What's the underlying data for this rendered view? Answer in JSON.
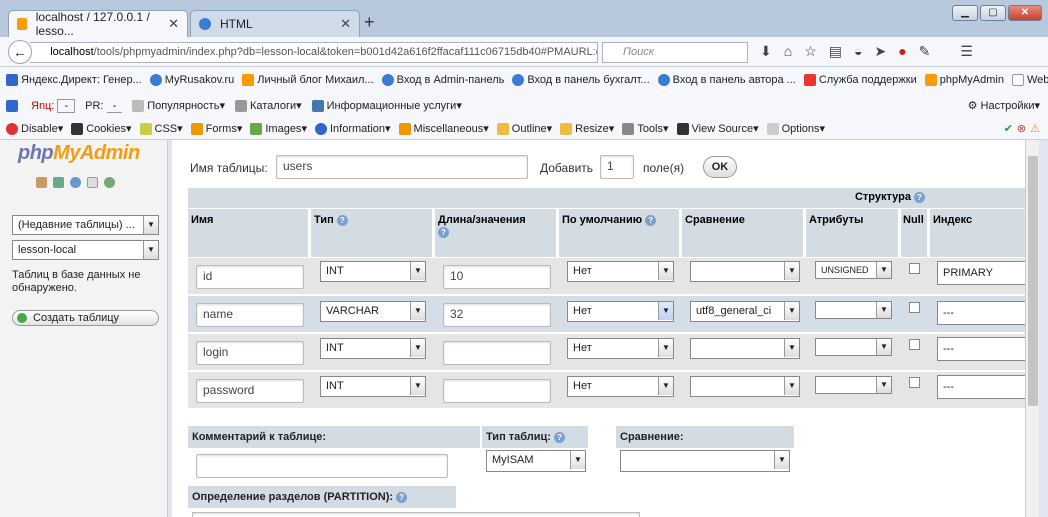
{
  "browser": {
    "tabs": [
      {
        "label": "localhost / 127.0.0.1 / lesso..."
      },
      {
        "label": "HTML"
      }
    ],
    "url_prefix": "localhost",
    "url_rest": "/tools/phpmyadmin/index.php?db=lesson-local&token=b001d42a616f2ffacaf111c06715db40#PMAURL:db=l",
    "search_placeholder": "Поиск",
    "bookmarks": [
      "Яндекс.Директ: Генер...",
      "MyRusakov.ru",
      "Личный блог Михаил...",
      "Вход в Admin-панель",
      "Вход в панель бухгалт...",
      "Вход в панель автора ...",
      "Служба поддержки",
      "phpMyAdmin",
      "WebMoney"
    ],
    "yandex_bar": {
      "tic": "Яnц:",
      "tic_val": "-",
      "pr": "PR:",
      "pr_val": "-",
      "items": [
        "Популярность",
        "Каталоги",
        "Информационные услуги"
      ],
      "settings": "Настройки"
    },
    "webdev": [
      "Disable",
      "Cookies",
      "CSS",
      "Forms",
      "Images",
      "Information",
      "Miscellaneous",
      "Outline",
      "Resize",
      "Tools",
      "View Source",
      "Options"
    ]
  },
  "sidebar": {
    "logo_php": "php",
    "logo_my": "MyAdmin",
    "recent": "(Недавние таблицы) ...",
    "db": "lesson-local",
    "no_tables": "Таблиц в базе данных не обнаружено.",
    "create": "Создать таблицу"
  },
  "form": {
    "table_name_label": "Имя таблицы:",
    "table_name": "users",
    "add_label": "Добавить",
    "add_count": "1",
    "fields_label": "поле(я)",
    "ok": "OK",
    "structure": "Структура",
    "columns": [
      "Имя",
      "Тип",
      "Длина/значения",
      "По умолчанию",
      "Сравнение",
      "Атрибуты",
      "Null",
      "Индекс"
    ],
    "rows": [
      {
        "name": "id",
        "type": "INT",
        "length": "10",
        "default": "Нет",
        "collation": "",
        "attributes": "UNSIGNED",
        "index": "PRIMARY"
      },
      {
        "name": "name",
        "type": "VARCHAR",
        "length": "32",
        "default": "Нет",
        "collation": "utf8_general_ci",
        "attributes": "",
        "index": "---"
      },
      {
        "name": "login",
        "type": "INT",
        "length": "",
        "default": "Нет",
        "collation": "",
        "attributes": "",
        "index": "---"
      },
      {
        "name": "password",
        "type": "INT",
        "length": "",
        "default": "Нет",
        "collation": "",
        "attributes": "",
        "index": "---"
      }
    ],
    "comment_label": "Комментарий к таблице:",
    "engine_label": "Тип таблиц:",
    "engine": "MyISAM",
    "collation_label": "Сравнение:",
    "partition_label": "Определение разделов (PARTITION):"
  }
}
